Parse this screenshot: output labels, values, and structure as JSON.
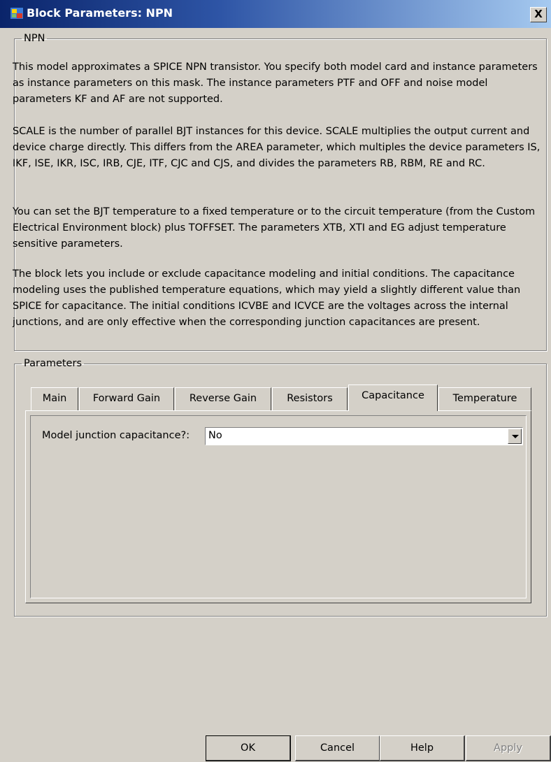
{
  "window": {
    "title": "Block Parameters: NPN",
    "close_label": "X"
  },
  "description": {
    "group_label": "NPN",
    "paragraphs": [
      "This model approximates a SPICE NPN transistor. You specify both model card and instance parameters as instance parameters on this mask. The instance parameters PTF and OFF and noise model parameters KF and AF are not supported.",
      "SCALE is the number of parallel BJT instances for this device. SCALE multiplies the output current and device charge directly. This differs from the AREA parameter, which multiples the device parameters IS, IKF, ISE, IKR, ISC, IRB, CJE, ITF, CJC and CJS, and divides the parameters RB, RBM, RE and RC.",
      "You can set the BJT temperature to a fixed temperature or to the circuit temperature (from the Custom Electrical Environment block) plus TOFFSET. The parameters XTB, XTI and EG adjust temperature sensitive parameters.",
      "The block lets you include or exclude capacitance modeling and initial conditions. The capacitance modeling uses the published temperature equations, which may yield a slightly different value than SPICE for capacitance. The initial conditions ICVBE and ICVCE are the voltages across the internal junctions, and are only effective when the corresponding junction capacitances are present."
    ]
  },
  "parameters": {
    "group_label": "Parameters",
    "tabs": [
      {
        "label": "Main"
      },
      {
        "label": "Forward Gain"
      },
      {
        "label": "Reverse Gain"
      },
      {
        "label": "Resistors"
      },
      {
        "label": "Capacitance"
      },
      {
        "label": "Temperature"
      }
    ],
    "active_tab": "Capacitance",
    "field_label": "Model junction capacitance?:",
    "field_value": "No"
  },
  "buttons": {
    "ok": "OK",
    "cancel": "Cancel",
    "help": "Help",
    "apply": "Apply"
  }
}
